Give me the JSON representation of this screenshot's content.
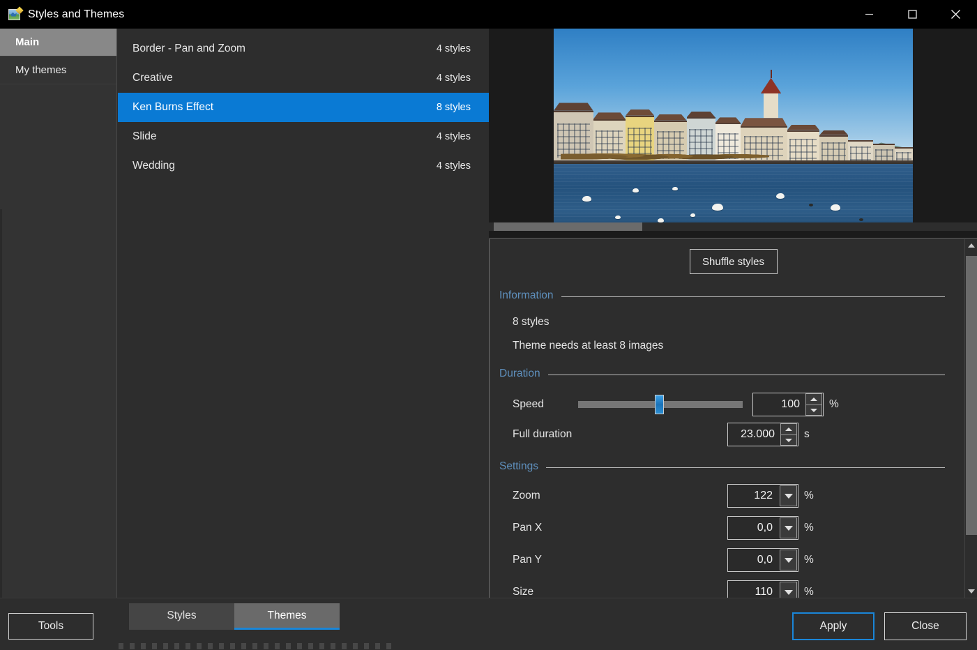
{
  "window": {
    "title": "Styles and Themes",
    "icon": "image-edit-icon",
    "controls": {
      "minimize": "minimize-icon",
      "maximize": "maximize-icon",
      "close": "close-icon"
    }
  },
  "sidebar": {
    "items": [
      {
        "label": "Main",
        "active": true
      },
      {
        "label": "My themes",
        "active": false
      }
    ]
  },
  "theme_list": {
    "rows": [
      {
        "name": "Border - Pan and Zoom",
        "count": "4 styles",
        "selected": false
      },
      {
        "name": "Creative",
        "count": "4 styles",
        "selected": false
      },
      {
        "name": "Ken Burns Effect",
        "count": "8 styles",
        "selected": true
      },
      {
        "name": "Slide",
        "count": "4 styles",
        "selected": false
      },
      {
        "name": "Wedding",
        "count": "4 styles",
        "selected": false
      }
    ]
  },
  "preview": {
    "description": "Lucerne riverfront with swans on the water"
  },
  "settings_panel": {
    "shuffle_label": "Shuffle styles",
    "sections": {
      "information": {
        "title": "Information",
        "lines": [
          "8 styles",
          "Theme needs at least 8 images"
        ]
      },
      "duration": {
        "title": "Duration",
        "speed": {
          "label": "Speed",
          "value": "100",
          "unit": "%",
          "slider_position_pct": 47
        },
        "full_duration": {
          "label": "Full duration",
          "value": "23.000",
          "unit": "s"
        }
      },
      "settings": {
        "title": "Settings",
        "fields": [
          {
            "label": "Zoom",
            "value": "122",
            "unit": "%"
          },
          {
            "label": "Pan X",
            "value": "0,0",
            "unit": "%"
          },
          {
            "label": "Pan Y",
            "value": "0,0",
            "unit": "%"
          },
          {
            "label": "Size",
            "value": "110",
            "unit": "%"
          }
        ]
      }
    }
  },
  "bottom_bar": {
    "tools_label": "Tools",
    "tabs": [
      {
        "label": "Styles",
        "active": false
      },
      {
        "label": "Themes",
        "active": true
      }
    ],
    "apply_label": "Apply",
    "close_label": "Close"
  },
  "colors": {
    "accent_blue": "#0a7ad4",
    "focus_blue": "#1a86d8",
    "section_header_blue": "#5e8fbc",
    "panel_bg": "#2d2d2d",
    "sidebar_bg": "#333333",
    "titlebar_bg": "#000000",
    "selected_sidebar_bg": "#888888"
  }
}
